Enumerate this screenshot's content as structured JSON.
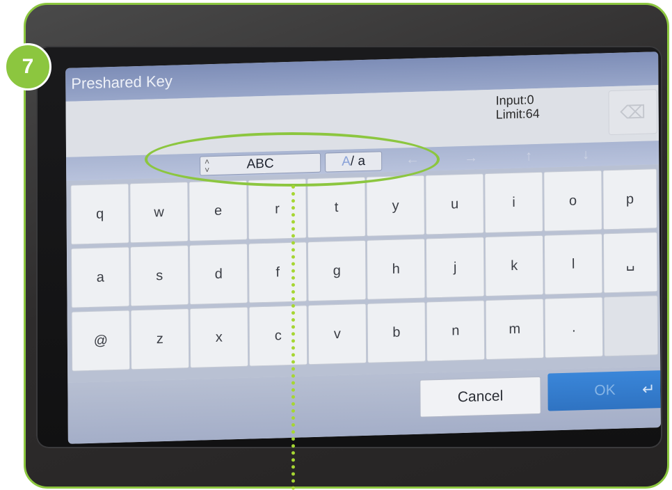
{
  "step": {
    "number": "7"
  },
  "screen": {
    "title": "Preshared Key",
    "counter": {
      "input": "Input:0",
      "limit": "Limit:64"
    },
    "toolbar": {
      "mode_label": "ABC",
      "case_upper": "A",
      "case_sep": "/",
      "case_lower": "a"
    },
    "keys": {
      "row1": [
        "q",
        "w",
        "e",
        "r",
        "t",
        "y",
        "u",
        "i",
        "o",
        "p"
      ],
      "row2": [
        "a",
        "s",
        "d",
        "f",
        "g",
        "h",
        "j",
        "k",
        "l",
        "␣"
      ],
      "row3": [
        "@",
        "z",
        "x",
        "c",
        "v",
        "b",
        "n",
        "m",
        "."
      ]
    },
    "cancel_label": "Cancel",
    "ok_label": "OK"
  },
  "colors": {
    "accent_green": "#8cc63f",
    "ok_blue": "#2f73c2",
    "titlebar": "#7d8db7"
  }
}
